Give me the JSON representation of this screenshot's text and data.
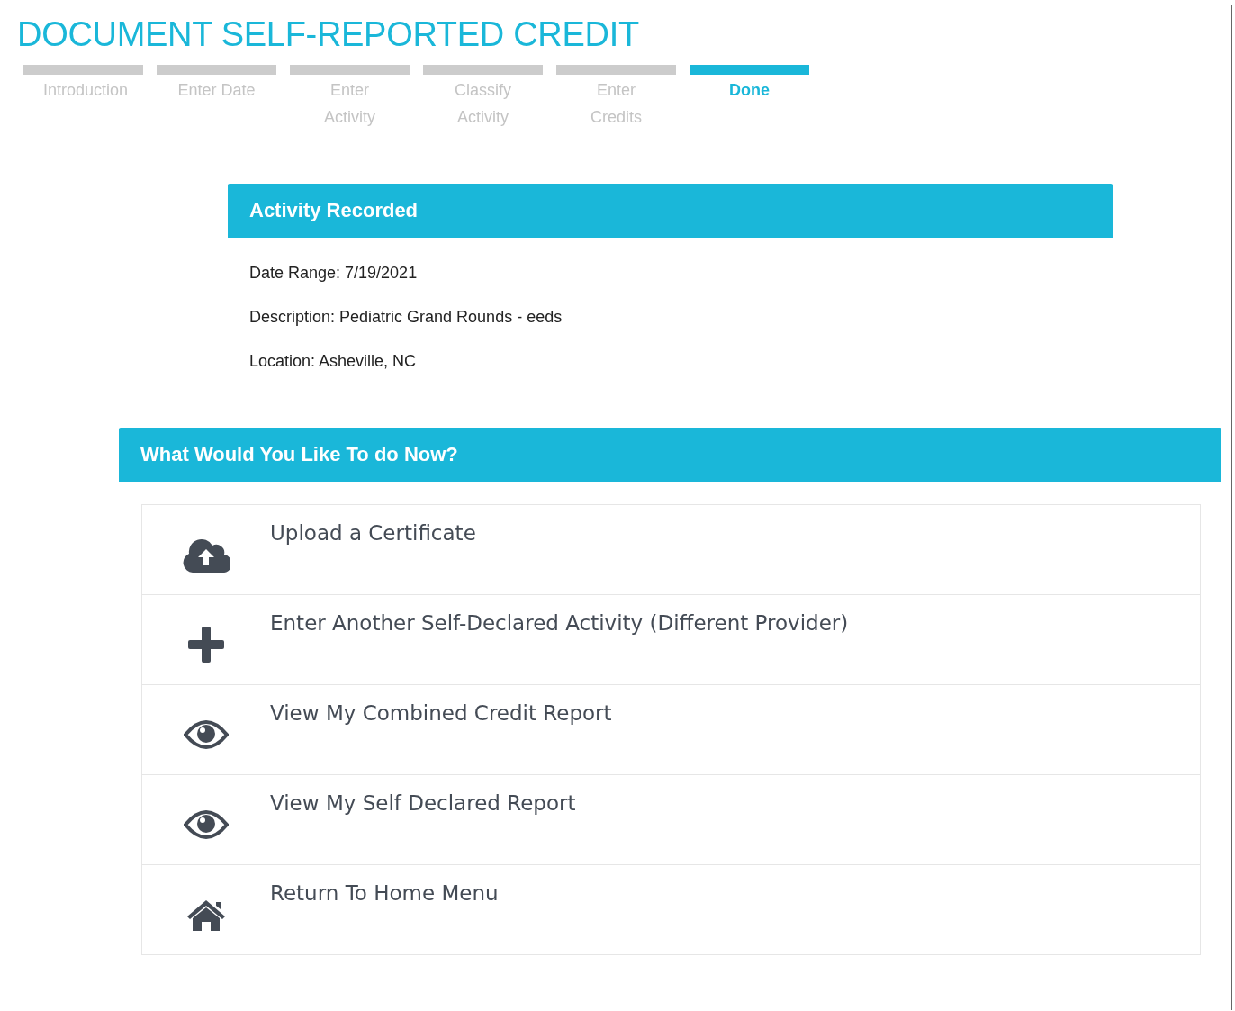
{
  "page_title": "DOCUMENT SELF-REPORTED CREDIT",
  "steps": [
    {
      "label": "Introduction",
      "selected": false
    },
    {
      "label": "Enter Date",
      "selected": false
    },
    {
      "label": "Enter Activity",
      "selected": false
    },
    {
      "label": "Classify Activity",
      "selected": false
    },
    {
      "label": "Enter Credits",
      "selected": false
    },
    {
      "label": "Done",
      "selected": true
    }
  ],
  "activity_panel": {
    "title": "Activity Recorded",
    "details": [
      "Date Range: 7/19/2021",
      "Description: Pediatric Grand Rounds - eeds",
      "Location: Asheville, NC"
    ]
  },
  "next_panel": {
    "title": "What Would You Like To do Now?",
    "actions": [
      {
        "kind": "upload",
        "label": "Upload a Certificate"
      },
      {
        "kind": "add",
        "label": "Enter Another Self-Declared Activity (Different Provider)"
      },
      {
        "kind": "view",
        "label": "View My Combined Credit Report"
      },
      {
        "kind": "view",
        "label": "View My Self Declared Report"
      },
      {
        "kind": "home",
        "label": "Return To Home Menu"
      }
    ]
  }
}
